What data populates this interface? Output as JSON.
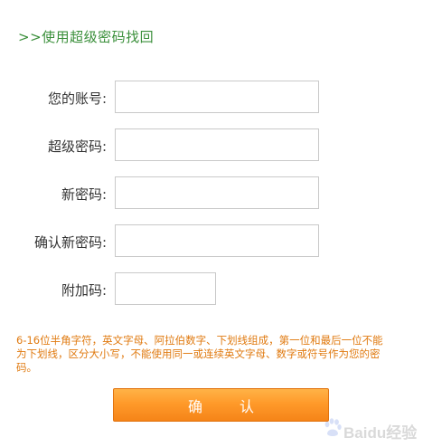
{
  "page": {
    "title": ">>使用超级密码找回"
  },
  "form": {
    "fields": [
      {
        "label": "您的账号:",
        "value": ""
      },
      {
        "label": "超级密码:",
        "value": ""
      },
      {
        "label": "新密码:",
        "value": ""
      },
      {
        "label": "确认新密码:",
        "value": ""
      },
      {
        "label": "附加码:",
        "value": ""
      }
    ],
    "hint": "6-16位半角字符，英文字母、阿拉伯数字、下划线组成，第一位和最后一位不能为下划线，区分大小写，不能使用同一或连续英文字母、数字或符号作为您的密码。",
    "confirm_label": "确 认"
  },
  "watermark": {
    "text": "Baidu经验"
  },
  "colors": {
    "title": "#3a8f3a",
    "hint": "#e07a10",
    "button": "#ff9a2a"
  }
}
